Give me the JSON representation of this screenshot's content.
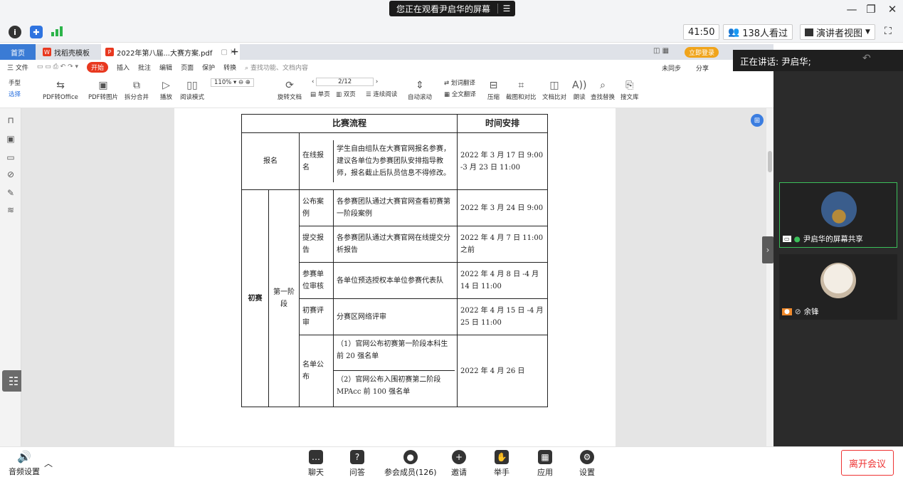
{
  "window": {
    "watching_text": "您正在观看尹启华的屏幕",
    "controls": [
      "—",
      "❐",
      "✕"
    ]
  },
  "info_bar": {
    "timer": "41:50",
    "viewers": "138人看过",
    "view_mode": "演讲者视图"
  },
  "wps": {
    "home_tab": "首页",
    "tabs": [
      {
        "label": "找稻壳模板"
      },
      {
        "label": "2022年第八届...大赛方案.pdf"
      }
    ],
    "login_button": "立即登录",
    "menu": [
      "三 文件",
      "开始",
      "插入",
      "批注",
      "编辑",
      "页面",
      "保护",
      "转换",
      "查找功能、文档内容"
    ],
    "sync": "未同步",
    "share": "分享",
    "ribbon": {
      "hand": "手型",
      "select": "选择",
      "pdf_to_office": "PDF转Office",
      "pdf_to_image": "PDF转图片",
      "split_merge": "拆分合并",
      "play": "播放",
      "read_mode": "阅读模式",
      "zoom": "110%",
      "page": "2/12",
      "rotate": "旋转文档",
      "single": "单页",
      "double": "双页",
      "continuous": "连续阅读",
      "auto_scroll": "自动滚动",
      "translate": "划词翻译",
      "full_translate": "全文翻译",
      "compress": "压缩",
      "screenshot": "截图和对比",
      "doc_compare": "文档比对",
      "read_aloud": "朗读",
      "find_replace": "查找替换",
      "search_lib": "搜文库"
    }
  },
  "document": {
    "headers": [
      "比赛流程",
      "时间安排"
    ],
    "register": {
      "label": "报名",
      "sub": "在线报名",
      "desc": "学生自由组队在大赛官网报名参赛，建议各单位为参赛团队安排指导教师，报名截止后队员信息不得修改。",
      "time": "2022 年 3 月 17 日 9:00 -3 月 23 日 11:00"
    },
    "round_label": "初赛",
    "stage_label": "第一阶段",
    "rows": [
      {
        "step": "公布案例",
        "desc": "各参赛团队通过大赛官网查看初赛第一阶段案例",
        "time": "2022 年 3 月 24 日 9:00"
      },
      {
        "step": "提交报告",
        "desc": "各参赛团队通过大赛官网在线提交分析报告",
        "time": "2022 年 4 月 7 日 11:00 之前"
      },
      {
        "step": "参赛单位审核",
        "desc": "各单位预选授权本单位参赛代表队",
        "time": "2022 年 4 月 8 日 -4 月 14 日 11:00"
      },
      {
        "step": "初赛评审",
        "desc": "分赛区网络评审",
        "time": "2022 年 4 月 15 日 -4 月 25 日 11:00"
      }
    ],
    "announce": {
      "step": "名单公布",
      "desc1": "（1）官网公布初赛第一阶段本科生前 20 强名单",
      "desc2": "（2）官网公布入围初赛第二阶段 MPAcc 前 100 强名单",
      "time": "2022 年 4 月 26 日"
    }
  },
  "right_panel": {
    "speaking": "正在讲话: 尹启华;",
    "participants": [
      {
        "name": "尹启华的屏幕共享"
      },
      {
        "name": "余锋"
      }
    ]
  },
  "bottom_bar": {
    "audio": "音频设置",
    "items": [
      "聊天",
      "问答",
      "参会成员(126)",
      "邀请",
      "举手",
      "应用",
      "设置"
    ],
    "leave": "离开会议"
  }
}
